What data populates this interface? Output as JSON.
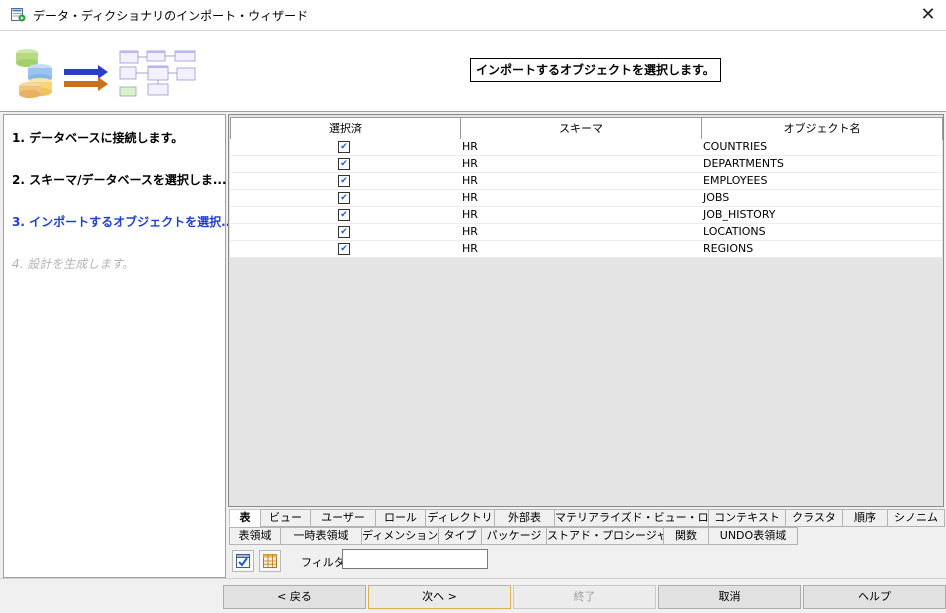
{
  "window": {
    "title": "データ・ディクショナリのインポート・ウィザード",
    "close_glyph": "✕"
  },
  "header": {
    "title": "インポートするオブジェクトを選択します。"
  },
  "steps": [
    {
      "label": "1. データベースに接続します。",
      "state": "done"
    },
    {
      "label": "2. スキーマ/データベースを選択しま...",
      "state": "done"
    },
    {
      "label": "3. インポートするオブジェクトを選択...",
      "state": "current"
    },
    {
      "label": "4. 設計を生成します。",
      "state": "pending"
    }
  ],
  "table": {
    "columns": [
      "選択済",
      "スキーマ",
      "オブジェクト名"
    ],
    "rows": [
      {
        "selected": true,
        "schema": "HR",
        "object": "COUNTRIES"
      },
      {
        "selected": true,
        "schema": "HR",
        "object": "DEPARTMENTS"
      },
      {
        "selected": true,
        "schema": "HR",
        "object": "EMPLOYEES"
      },
      {
        "selected": true,
        "schema": "HR",
        "object": "JOBS"
      },
      {
        "selected": true,
        "schema": "HR",
        "object": "JOB_HISTORY"
      },
      {
        "selected": true,
        "schema": "HR",
        "object": "LOCATIONS"
      },
      {
        "selected": true,
        "schema": "HR",
        "object": "REGIONS"
      }
    ]
  },
  "tabs_row1": [
    "表",
    "ビュー",
    "ユーザー",
    "ロール",
    "ディレクトリ",
    "外部表",
    "マテリアライズド・ビュー・ログ",
    "コンテキスト",
    "クラスタ",
    "順序",
    "シノニム"
  ],
  "tabs_row2": [
    "表領域",
    "一時表領域",
    "ディメンション",
    "タイプ",
    "パッケージ",
    "ストアド・プロシージャ",
    "関数",
    "UNDO表領域"
  ],
  "active_tab": "表",
  "filter": {
    "label": "フィルタ:",
    "value": ""
  },
  "toolbar_icons": [
    "select-all-icon",
    "grid-icon"
  ],
  "buttons": {
    "back": "< 戻る",
    "next": "次へ >",
    "finish": "終了",
    "cancel": "取消",
    "help": "ヘルプ"
  },
  "colors": {
    "current_step": "#1f3fd4",
    "pending_step": "#b4b4b4",
    "check": "#1a5bd6",
    "next_button_border": "#e0b04e"
  }
}
